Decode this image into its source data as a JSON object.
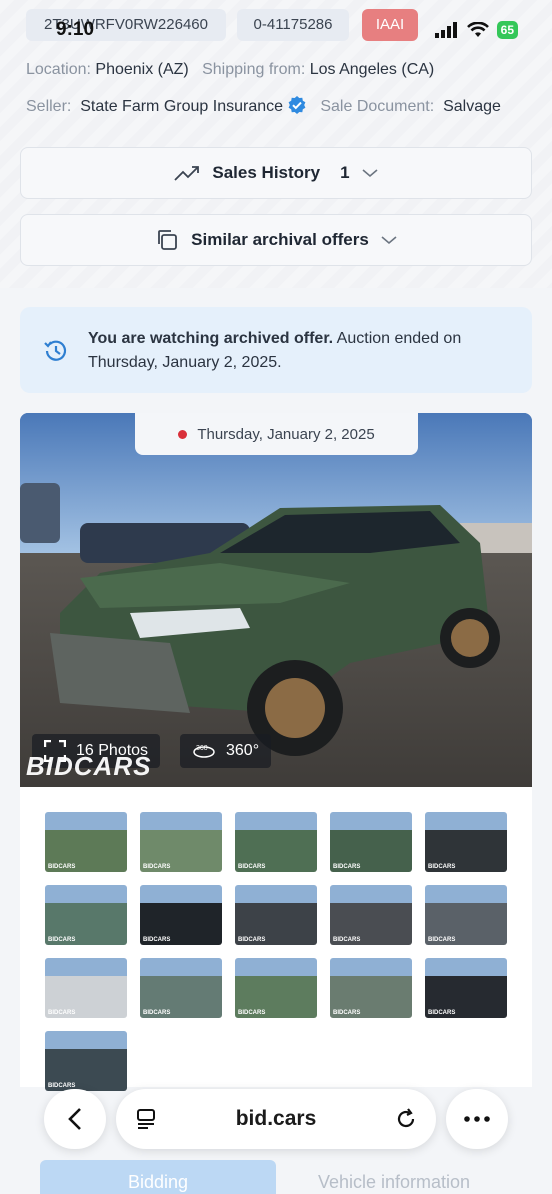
{
  "status_bar": {
    "time": "9:10",
    "battery": "65"
  },
  "header": {
    "vin": "2T3UWRFV0RW226460",
    "lot": "0-41175286",
    "auction_badge": "IAAI"
  },
  "details": {
    "location_label": "Location:",
    "location_value": "Phoenix (AZ)",
    "shipping_label": "Shipping from:",
    "shipping_value": "Los Angeles (CA)",
    "seller_label": "Seller:",
    "seller_value": "State Farm Group Insurance",
    "document_label": "Sale Document:",
    "document_value": "Salvage"
  },
  "sections": {
    "sales_history_label": "Sales History",
    "sales_history_count": "1",
    "similar_offers_label": "Similar archival offers"
  },
  "notice": {
    "bold_text": "You are watching archived offer.",
    "rest_text": " Auction ended on Thursday, January 2, 2025."
  },
  "photo": {
    "date": "Thursday, January 2, 2025",
    "photos_label": "16 Photos",
    "view360_label": "360°",
    "watermark": "BIDCARS"
  },
  "thumbnails": [
    {
      "name": "thumb-front-left",
      "color": "#5d7a57"
    },
    {
      "name": "thumb-front-right",
      "color": "#6f8a6a"
    },
    {
      "name": "thumb-rear-left",
      "color": "#4f6f54"
    },
    {
      "name": "thumb-rear-right",
      "color": "#45614c"
    },
    {
      "name": "thumb-interior-door",
      "color": "#2f3438"
    },
    {
      "name": "thumb-side-left",
      "color": "#58786a"
    },
    {
      "name": "thumb-dashboard",
      "color": "#1f2429"
    },
    {
      "name": "thumb-rear-seats",
      "color": "#3d4248"
    },
    {
      "name": "thumb-door-label",
      "color": "#4a4d52"
    },
    {
      "name": "thumb-engine",
      "color": "#5a6168"
    },
    {
      "name": "thumb-key-fob",
      "color": "#cdd1d5"
    },
    {
      "name": "thumb-front-damage",
      "color": "#647b74"
    },
    {
      "name": "thumb-side-profile",
      "color": "#5d7c5e"
    },
    {
      "name": "thumb-side-right",
      "color": "#6a7c70"
    },
    {
      "name": "thumb-odometer",
      "color": "#262a30"
    },
    {
      "name": "thumb-rear",
      "color": "#3c4a52"
    }
  ],
  "thumb_watermark": "BIDCARS",
  "browser": {
    "url": "bid.cars"
  },
  "bottom_tabs": {
    "bidding": "Bidding",
    "vehicle_info": "Vehicle information"
  }
}
